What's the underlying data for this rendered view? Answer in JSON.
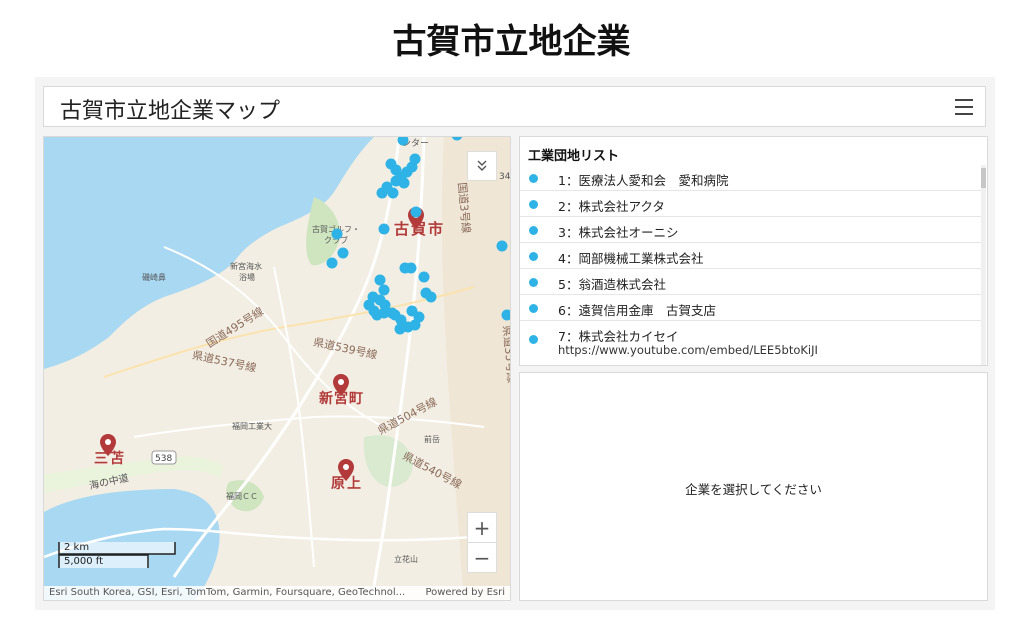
{
  "page": {
    "title": "古賀市立地企業"
  },
  "header": {
    "app_title": "古賀市立地企業マップ",
    "menu_icon": "hamburger-menu-icon"
  },
  "map": {
    "labels": {
      "koga": "古賀市",
      "shingu": "新宮町",
      "miko": "三苫",
      "harugami": "原上",
      "golf": "古賀ゴルフ・\nクラブ",
      "golf_line1": "古賀ゴルフ・",
      "golf_line2": "クラブ",
      "shinguhama_1": "新宮海水",
      "shinguhama_2": "浴場",
      "isozaki": "磯崎鼻",
      "route495": "国道495号線",
      "pref537": "県道537号線",
      "pref539": "県道539号線",
      "pref504": "県道504号線",
      "pref540": "県道540号線",
      "route3": "国道3号線",
      "pref35": "県道35号線",
      "fukuoka_kodai": "福岡工業大",
      "fukuoka_cc": "福岡ＣＣ",
      "umi_nakamichi": "海の中道",
      "maeda": "前岳",
      "tachibana": "立花山",
      "shield538": "538",
      "center_frag": "ンター",
      "num34": "34"
    },
    "scalebar": {
      "metric": "2 km",
      "imperial": "5,000 ft"
    },
    "zoom_in": "+",
    "zoom_out": "−",
    "attribution": "Esri South Korea, GSI, Esri, TomTom, Garmin, Foursquare, GeoTechnol...",
    "powered_by": "Powered by Esri",
    "colors": {
      "marker": "#2fb3e6",
      "city_label": "#b23a3a",
      "water": "#a9d8f2",
      "land": "#f3eee3"
    }
  },
  "list": {
    "title": "工業団地リスト",
    "items": [
      {
        "label": "1：医療法人愛和会　愛和病院"
      },
      {
        "label": "2：株式会社アクタ"
      },
      {
        "label": "3：株式会社オーニシ"
      },
      {
        "label": "4：岡部機械工業株式会社"
      },
      {
        "label": "5：翁酒造株式会社"
      },
      {
        "label": "6：遠賀信用金庫　古賀支店"
      },
      {
        "label": "7：株式会社カイセイ",
        "sub": "https://www.youtube.com/embed/LEE5btoKiJI"
      }
    ]
  },
  "detail": {
    "placeholder": "企業を選択してください"
  }
}
